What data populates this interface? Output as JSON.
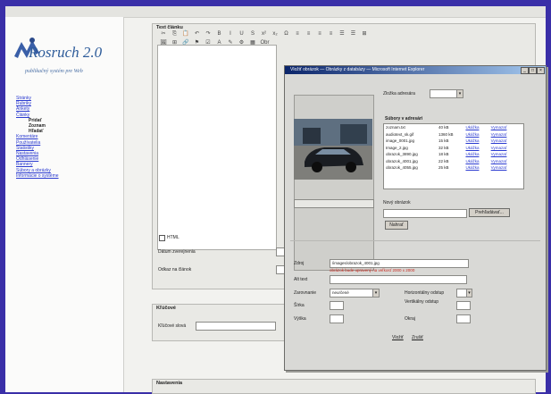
{
  "app": {
    "logo_title": "Rosruch 2.0",
    "logo_subtitle": "publikačný systém pre Web",
    "accent": "#3a2fa8"
  },
  "sidebar": {
    "items": [
      {
        "label": "Stránky",
        "level": 0
      },
      {
        "label": "Rubriky",
        "level": 0
      },
      {
        "label": "Ankety",
        "level": 0
      },
      {
        "label": "Články",
        "level": 0
      },
      {
        "label": "Pridať",
        "level": 1
      },
      {
        "label": "Zoznam",
        "level": 1
      },
      {
        "label": "Hľadať",
        "level": 1
      },
      {
        "label": "Komentáre",
        "level": 0
      },
      {
        "label": "Používatelia",
        "level": 0
      },
      {
        "label": "Štatistiky",
        "level": 0
      },
      {
        "label": "Nastavenia",
        "level": 0
      },
      {
        "label": "Odhlásenie",
        "level": 0
      },
      {
        "label": "Bannery",
        "level": 0
      },
      {
        "label": "Súbory a obrázky",
        "level": 0
      },
      {
        "label": "Informácie o systéme",
        "level": 0
      }
    ]
  },
  "editor_panel": {
    "title": "Text článku",
    "html_checkbox_label": "HTML",
    "datum_label": "Dátum zverejnenia",
    "odkaz_label": "Odkaz na článok",
    "toolbar_row1": [
      "✂",
      "⎘",
      "📋",
      "↶",
      "↷",
      "B",
      "I",
      "U",
      "S",
      "x²",
      "x₂",
      "Ω",
      "≡",
      "≡",
      "≡",
      "≡",
      "☰",
      "☰",
      "⊞"
    ],
    "toolbar_row2": [
      "🖼",
      "⊞",
      "🔗",
      "⚑",
      "☑",
      "A",
      "✎",
      "⚙",
      "▦",
      "Obr"
    ]
  },
  "keywords_panel": {
    "title": "Kľúčové",
    "field_label": "Kľúčové slová"
  },
  "bottom_panel": {
    "title": "Nastavenia"
  },
  "dialog": {
    "title": "Vložiť obrázok — Obrázky z databázy — Microsoft Internet Explorer",
    "folder_label": "Zložka adresára",
    "files_header": "Súbory v adresári",
    "files": [
      {
        "name": "zoznam.txt",
        "size": "40 kB"
      },
      {
        "name": "audiotext_sk.gif",
        "size": "1360 kB"
      },
      {
        "name": "image_0001.jpg",
        "size": "15 kB"
      },
      {
        "name": "Image_2.jpg",
        "size": "32 kB"
      },
      {
        "name": "obrazok_3890.jpg",
        "size": "18 kB"
      },
      {
        "name": "obrazok_4001.jpg",
        "size": "22 kB"
      },
      {
        "name": "obrazok_4055.jpg",
        "size": "25 kB"
      }
    ],
    "file_action_view": "Ukážka",
    "file_action_delete": "Vymazať",
    "upload_label": "Nový obrázok",
    "browse_button": "Prehľadávať...",
    "upload_button": "Nahrať",
    "src_label": "Zdroj",
    "src_value": "/images/obrazok_4001.jpg",
    "src_warning": "obrázok bude upravený na veľkosť 2000 x 2000",
    "alt_label": "Alt text",
    "align_label": "Zarovnanie",
    "align_value": "neurčené",
    "hspace_label": "Horizontálny odstup",
    "width_label": "Šírka",
    "vspace_label": "Vertikálny odstup",
    "height_label": "Výška",
    "border_label": "Okraj",
    "ok_button": "Vložiť",
    "cancel_button": "Zrušiť"
  }
}
